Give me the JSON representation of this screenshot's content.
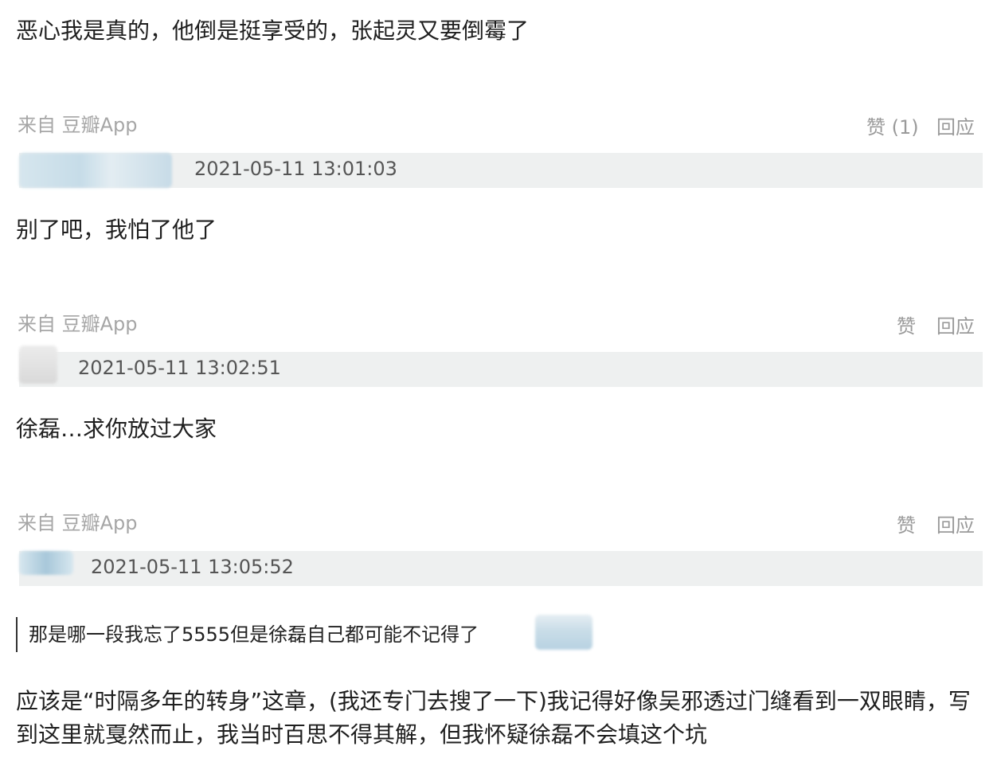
{
  "comments": [
    {
      "text": "恶心我是真的，他倒是挺享受的，张起灵又要倒霉了",
      "source": "来自 豆瓣App",
      "like": "赞 (1)",
      "reply": "回应"
    },
    {
      "timestamp": "2021-05-11 13:01:03",
      "text": "别了吧，我怕了他了",
      "source": "来自 豆瓣App",
      "like": "赞",
      "reply": "回应"
    },
    {
      "timestamp": "2021-05-11 13:02:51",
      "text": "徐磊…求你放过大家",
      "source": "来自 豆瓣App",
      "like": "赞",
      "reply": "回应"
    },
    {
      "timestamp": "2021-05-11 13:05:52",
      "quote": "那是哪一段我忘了5555但是徐磊自己都可能不记得了",
      "text_line1": "应该是“时隔多年的转身”这章，(我还专门去搜了一下)我记得好像吴邪透过门缝看到一双眼睛，写",
      "text_line2": "到这里就戛然而止，我当时百思不得其解，但我怀疑徐磊不会填这个坑"
    }
  ],
  "colors": {
    "meta_bar": "#eef0f0",
    "source_gray": "#a6a6a6",
    "blur_blue": "#c9dde8"
  }
}
